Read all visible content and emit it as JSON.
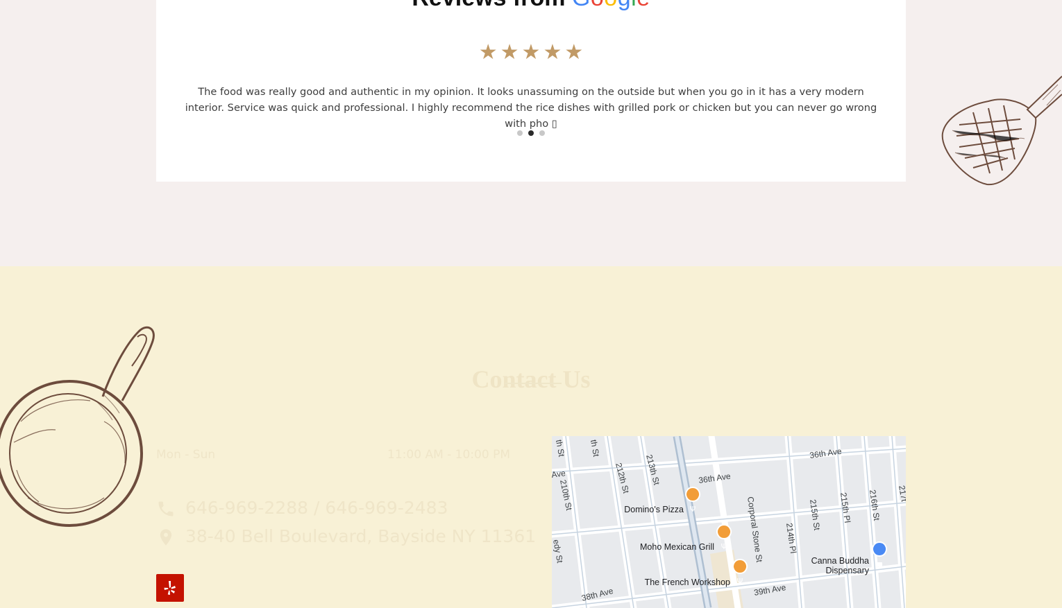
{
  "reviews": {
    "heading_prefix": "Reviews from",
    "google_letters": [
      "G",
      "o",
      "o",
      "g",
      "l",
      "e"
    ],
    "rating": 5,
    "text": "The food was really good and authentic in my opinion. It looks unassuming on the outside but when you go in it has a very modern interior. Service was quick and professional. I highly recommend the rice dishes with grilled pork or chicken but you can never go wrong with pho ▯",
    "slide_count": 3,
    "active_slide": 2
  },
  "contact": {
    "title": "Contact Us",
    "hours": {
      "days": "Mon - Sun",
      "time": "11:00 AM - 10:00 PM"
    },
    "phone": "646-969-2288 / 646-969-2483",
    "address": "38-40 Bell Boulevard, Bayside NY 11361",
    "social": {
      "yelp_icon": "yelp-icon"
    }
  },
  "map": {
    "streets": [
      "36th Ave",
      "36th Ave",
      "212th St",
      "213th St",
      "210th St",
      "Corporal Stone St",
      "214th Pl",
      "215th St",
      "215th Pl",
      "216th St",
      "38th Ave",
      "39th Ave",
      "th St",
      "th St",
      "Ave",
      "edy St",
      "217t"
    ],
    "places": [
      {
        "name": "Domino's Pizza",
        "icon": "restaurant-pin-icon"
      },
      {
        "name": "Moho Mexican Grill",
        "icon": "restaurant-pin-icon"
      },
      {
        "name": "The French Workshop",
        "icon": "restaurant-pin-icon"
      },
      {
        "name_line1": "Canna Buddha",
        "name_line2": "Dispensary",
        "icon": "shop-pin-icon"
      }
    ]
  },
  "colors": {
    "star": "#c19a66",
    "reviews_bg": "#f5efee",
    "contact_bg": "#f8f1d6",
    "yelp": "#c41200",
    "sketch": "#6d4c3d"
  }
}
